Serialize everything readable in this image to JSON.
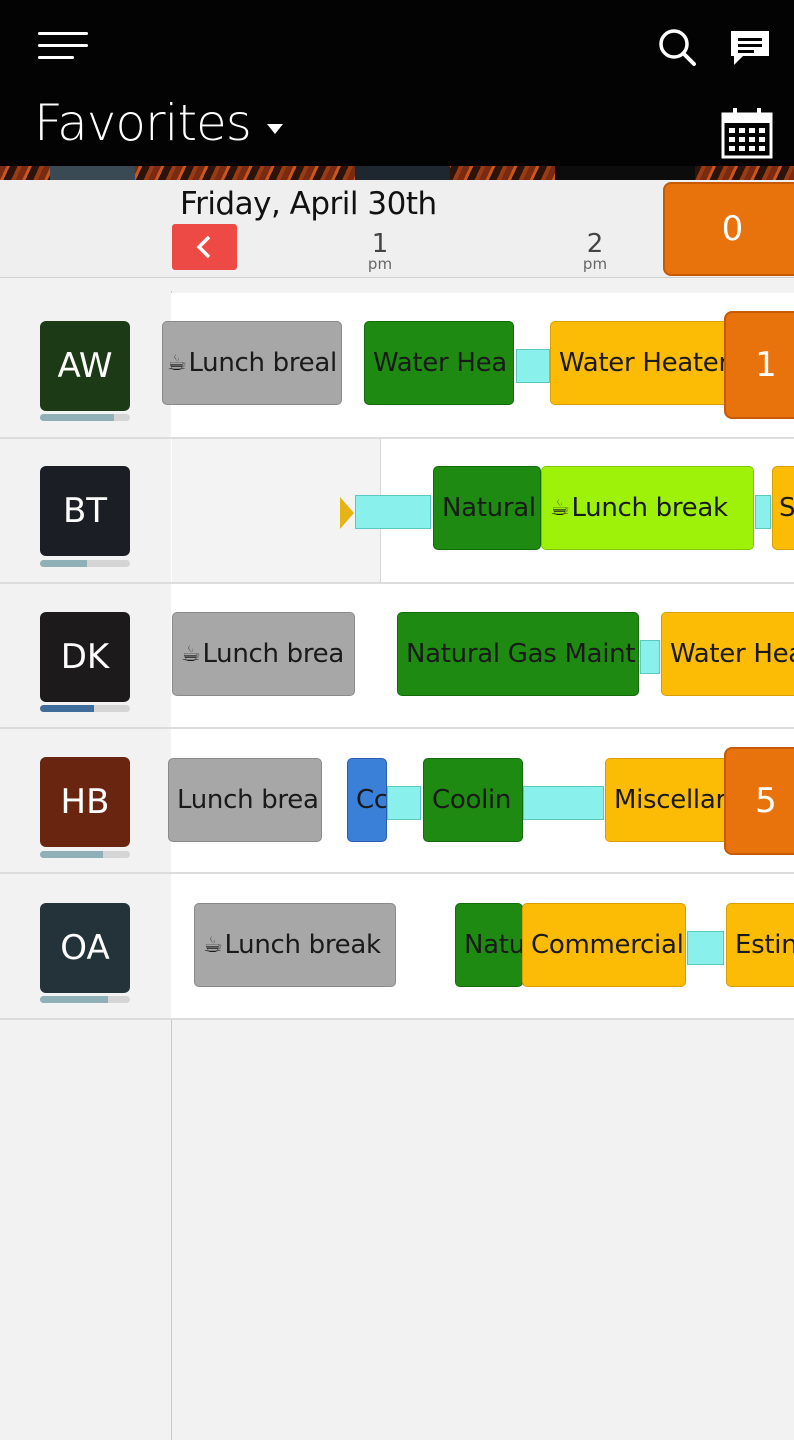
{
  "header": {
    "title": "Favorites",
    "colors": {
      "bar": "#030303",
      "text": "#ffffff"
    },
    "icons": [
      "hamburger-icon",
      "search-icon",
      "chat-icon",
      "dropdown-caret-icon",
      "calendar-icon"
    ]
  },
  "timeline": {
    "date": "Friday, April 30th",
    "hours": [
      {
        "num": "1",
        "ampm": "pm"
      },
      {
        "num": "2",
        "ampm": "pm"
      }
    ],
    "top_badge": "0",
    "prev_color": "#ee4a45"
  },
  "rows": [
    {
      "initials": "AW",
      "progress": 0.82,
      "badge": "1",
      "jobs": [
        "Lunch breal",
        "Water Hea",
        "Water Heater"
      ]
    },
    {
      "initials": "BT",
      "progress": 0.52,
      "jobs": [
        "Natural",
        "Lunch break",
        "S"
      ]
    },
    {
      "initials": "DK",
      "progress": 0.6,
      "jobs": [
        "Lunch brea",
        "Natural Gas Maint",
        "Water Hea"
      ]
    },
    {
      "initials": "HB",
      "progress": 0.7,
      "badge": "5",
      "jobs": [
        "Lunch brea",
        "Cc",
        "Coolin",
        "Miscellar"
      ]
    },
    {
      "initials": "OA",
      "progress": 0.75,
      "jobs": [
        "Lunch break",
        "Natu",
        "Commercial",
        "Estin"
      ]
    }
  ],
  "cup_glyph": "☕"
}
